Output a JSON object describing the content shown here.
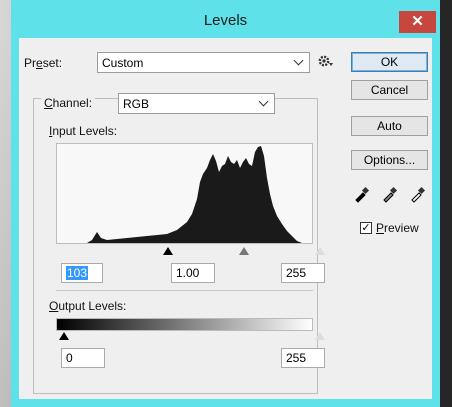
{
  "dialog": {
    "title": "Levels",
    "close_glyph": "✕"
  },
  "preset": {
    "label_prefix": "Pr",
    "label_underlined": "e",
    "label_suffix": "set:",
    "value": "Custom",
    "gear_icon": "gear-icon"
  },
  "channel": {
    "label_underlined": "C",
    "label_suffix": "hannel:",
    "value": "RGB"
  },
  "input_levels": {
    "label_underlined": "I",
    "label_suffix": "nput Levels:",
    "black": "103",
    "gamma": "1.00",
    "white": "255"
  },
  "output_levels": {
    "label_underlined": "O",
    "label_suffix": "utput Levels:",
    "black": "0",
    "white": "255"
  },
  "buttons": {
    "ok": "OK",
    "cancel": "Cancel",
    "auto": "Auto",
    "options": "Options..."
  },
  "preview": {
    "label_underlined": "P",
    "label_suffix": "review",
    "checked": true,
    "check_glyph": "✓"
  },
  "colors": {
    "titlebar": "#5ee1e8",
    "close": "#c7473f",
    "selection": "#3399ff"
  }
}
